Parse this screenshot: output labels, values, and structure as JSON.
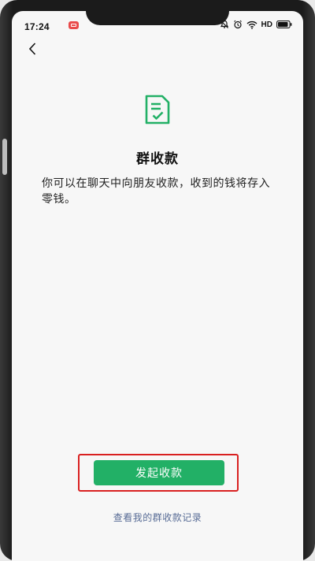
{
  "status_bar": {
    "time": "17:24",
    "network_label": "HD",
    "icons": [
      "app-notification-icon",
      "mute-icon",
      "alarm-icon",
      "wifi-icon",
      "battery-icon"
    ]
  },
  "nav": {
    "back_icon": "chevron-left-icon"
  },
  "main": {
    "icon": "bill-check-icon",
    "title": "群收款",
    "description": "你可以在聊天中向朋友收款，收到的钱将存入零钱。"
  },
  "actions": {
    "start_button_label": "发起收款",
    "records_link_label": "查看我的群收款记录"
  },
  "colors": {
    "accent_green": "#22b066",
    "link_blue": "#576b95",
    "highlight_red": "#d92020",
    "background": "#f7f7f7"
  }
}
